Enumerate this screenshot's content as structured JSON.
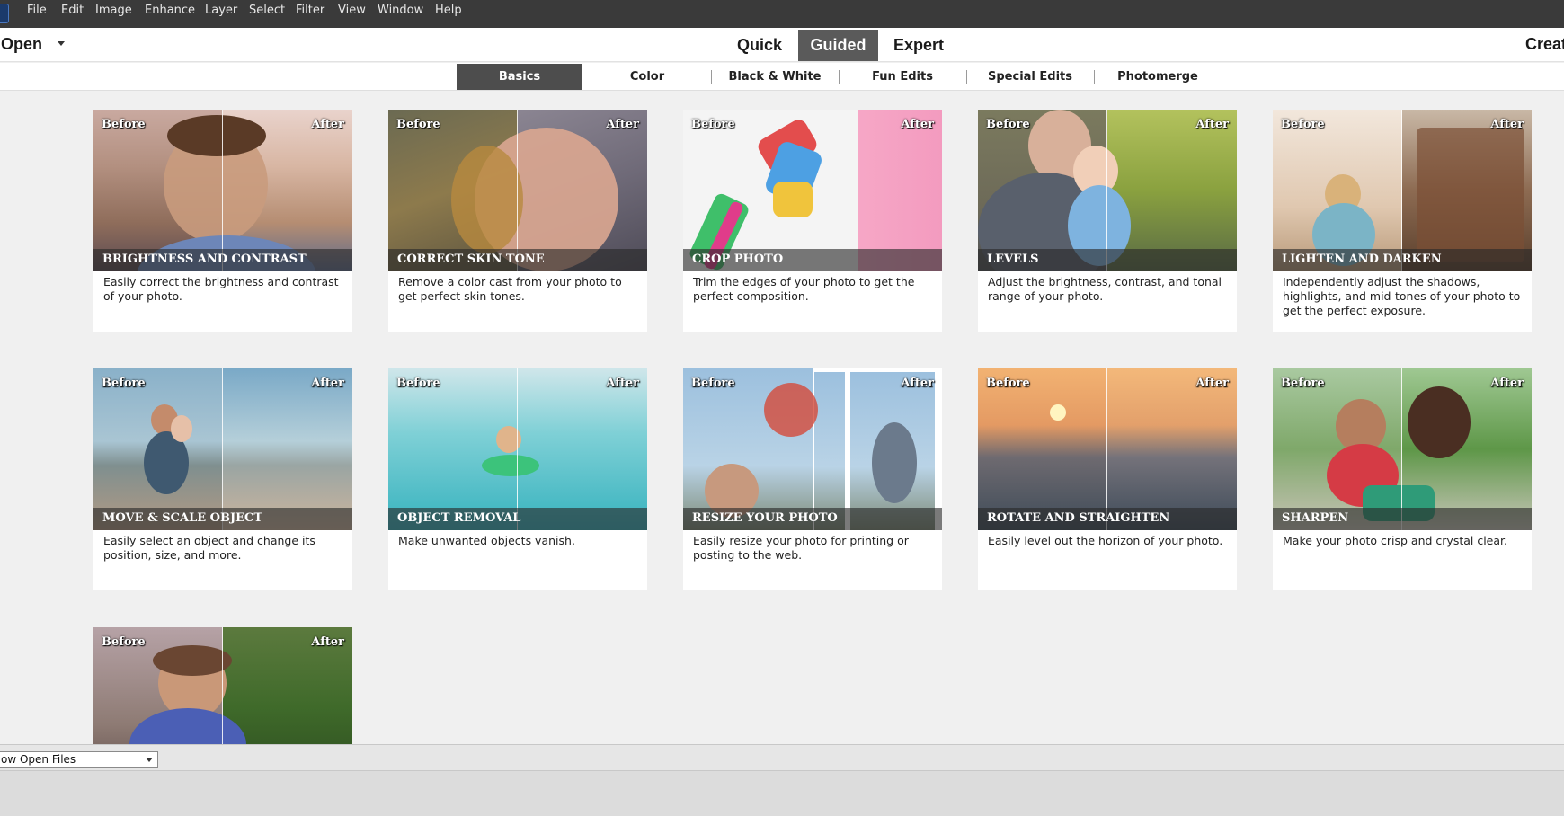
{
  "menu": [
    "File",
    "Edit",
    "Image",
    "Enhance",
    "Layer",
    "Select",
    "Filter",
    "View",
    "Window",
    "Help"
  ],
  "modebar": {
    "open_label": "Open",
    "tabs": [
      "Quick",
      "Guided",
      "Expert"
    ],
    "active_tab": "Guided",
    "create_label": "Creat"
  },
  "subtabs": {
    "items": [
      "Basics",
      "Color",
      "Black & White",
      "Fun Edits",
      "Special Edits",
      "Photomerge"
    ],
    "active": "Basics"
  },
  "labels": {
    "before": "Before",
    "after": "After"
  },
  "cards": [
    {
      "title": "BRIGHTNESS AND CONTRAST",
      "desc": "Easily correct the brightness and contrast of your photo."
    },
    {
      "title": "CORRECT SKIN TONE",
      "desc": "Remove a color cast from your photo to get perfect skin tones."
    },
    {
      "title": "CROP PHOTO",
      "desc": "Trim the edges of your photo to get the perfect composition."
    },
    {
      "title": "LEVELS",
      "desc": "Adjust the brightness, contrast, and tonal range of your photo."
    },
    {
      "title": "LIGHTEN AND DARKEN",
      "desc": "Independently adjust the shadows, highlights, and mid-tones of your photo to get the perfect exposure."
    },
    {
      "title": "MOVE & SCALE OBJECT",
      "desc": "Easily select an object and change its position, size, and more."
    },
    {
      "title": "OBJECT REMOVAL",
      "desc": "Make unwanted objects vanish."
    },
    {
      "title": "RESIZE YOUR PHOTO",
      "desc": "Easily resize your photo for printing or posting to the web."
    },
    {
      "title": "ROTATE AND STRAIGHTEN",
      "desc": "Easily level out the horizon of your photo."
    },
    {
      "title": "SHARPEN",
      "desc": "Make your photo crisp and crystal clear."
    },
    {
      "title": "",
      "desc": ""
    }
  ],
  "bottom": {
    "open_files_select": "ow Open Files"
  }
}
